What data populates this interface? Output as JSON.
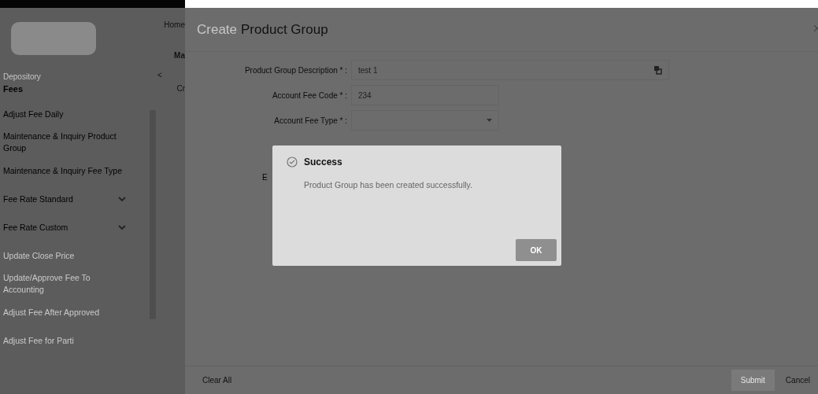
{
  "sidebar": {
    "section": "Depository",
    "group": "Fees",
    "items": [
      {
        "label": "Adjust Fee Daily",
        "expandable": false
      },
      {
        "label": "Maintenance & Inquiry Product Group",
        "expandable": false
      },
      {
        "label": "Maintenance & Inquiry Fee Type",
        "expandable": false
      },
      {
        "label": "Fee Rate Standard",
        "expandable": true
      },
      {
        "label": "Fee Rate Custom",
        "expandable": true
      },
      {
        "label": "Update Close Price",
        "expandable": false
      },
      {
        "label": "Update/Approve Fee To Accounting",
        "expandable": false
      },
      {
        "label": "Adjust Fee After Approved",
        "expandable": false
      },
      {
        "label": "Adjust Fee for Parti",
        "expandable": false
      }
    ]
  },
  "background_page": {
    "nav": "Home",
    "tab": "Ma",
    "collapse": "<",
    "breadcrumb": "Cr"
  },
  "modal": {
    "title_prefix": "Create",
    "title": "Product Group",
    "fields": [
      {
        "kind": "text",
        "label": "Product Group Description * :",
        "value": "test 1",
        "wide": true
      },
      {
        "kind": "text",
        "label": "Account Fee Code * :",
        "value": "234",
        "wide": false
      },
      {
        "kind": "select",
        "label": "Account Fee Type * :",
        "wide": false
      }
    ],
    "hidden_label": "E",
    "footer": {
      "clear": "Clear All",
      "submit": {
        "label": "Submit",
        "disabled": true
      },
      "cancel": "Cancel"
    }
  },
  "dialog": {
    "title": "Success",
    "message": "Product Group has been created successfully.",
    "button": {
      "label": "OK",
      "disabled": true
    }
  }
}
